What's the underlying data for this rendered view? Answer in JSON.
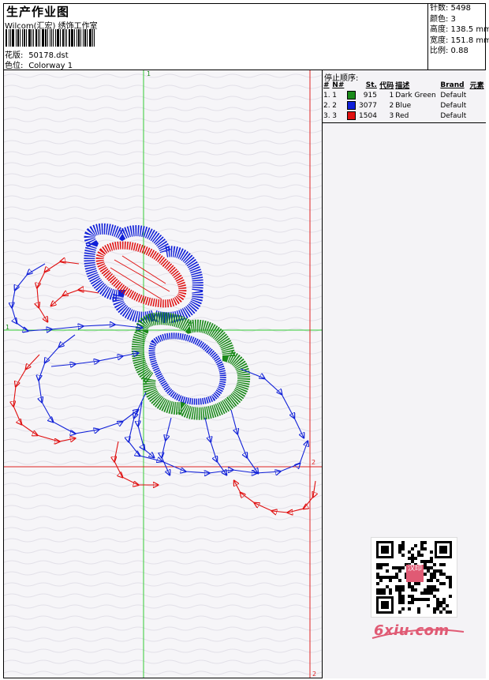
{
  "header": {
    "title": "生产作业图",
    "studio": "Wilcom(汇宏) 绣饰工作室",
    "file_label": "花版:",
    "file_value": "50178.dst",
    "colorway_label": "色位:",
    "colorway_value": "Colorway 1"
  },
  "stats": {
    "stitches": "针数: 5498",
    "colors": "颜色: 3",
    "height": "高度: 138.5 mm",
    "width": "宽度: 151.8 mm",
    "scale": "比例: 0.88"
  },
  "canvas": {
    "axis_marks": [
      "1",
      "1",
      "2",
      "2"
    ]
  },
  "stop_sequence": {
    "title": "停止顺序:",
    "columns": [
      "#",
      "N#",
      "St.",
      "代码",
      "描述",
      "Brand",
      "元素"
    ],
    "rows": [
      {
        "idx": "1.",
        "n": "1",
        "color": "#1a8a1a",
        "st": "915",
        "code": "1",
        "desc": "Dark Green",
        "brand": "Default"
      },
      {
        "idx": "2.",
        "n": "2",
        "color": "#1020d8",
        "st": "3077",
        "code": "2",
        "desc": "Blue",
        "brand": "Default"
      },
      {
        "idx": "3.",
        "n": "3",
        "color": "#e01010",
        "st": "1504",
        "code": "3",
        "desc": "Red",
        "brand": "Default"
      }
    ]
  },
  "watermark": {
    "text": "6xiu.com",
    "seal": "汉印"
  },
  "colors": {
    "green": "#1a8a1a",
    "blue": "#1020d8",
    "red": "#e01010",
    "axis_green": "#33cc33",
    "axis_red": "#dd2222"
  },
  "icons": [
    "barcode-icon",
    "qr-code-icon",
    "color-swatch-icon"
  ]
}
